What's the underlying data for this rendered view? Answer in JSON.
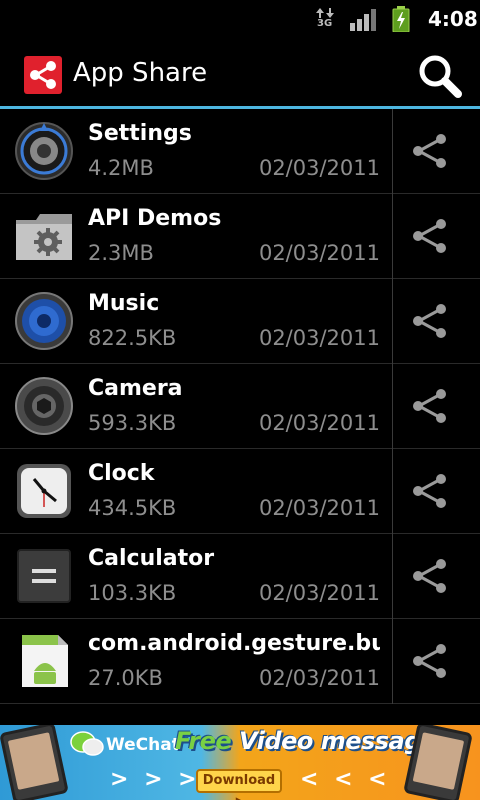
{
  "status_bar": {
    "network": "3G",
    "time": "4:08"
  },
  "header": {
    "title": "App Share",
    "logo_icon": "share-logo-icon",
    "search_icon": "search-icon",
    "accent_color": "#4eb7e1"
  },
  "apps": [
    {
      "name": "Settings",
      "size": "4.2MB",
      "date": "02/03/2011",
      "icon": "settings-icon"
    },
    {
      "name": "API Demos",
      "size": "2.3MB",
      "date": "02/03/2011",
      "icon": "folder-gear-icon"
    },
    {
      "name": "Music",
      "size": "822.5KB",
      "date": "02/03/2011",
      "icon": "speaker-icon"
    },
    {
      "name": "Camera",
      "size": "593.3KB",
      "date": "02/03/2011",
      "icon": "camera-icon"
    },
    {
      "name": "Clock",
      "size": "434.5KB",
      "date": "02/03/2011",
      "icon": "clock-icon"
    },
    {
      "name": "Calculator",
      "size": "103.3KB",
      "date": "02/03/2011",
      "icon": "calculator-icon"
    },
    {
      "name": "com.android.gesture.builder",
      "size": "27.0KB",
      "date": "02/03/2011",
      "icon": "android-app-icon"
    }
  ],
  "banner": {
    "brand": "WeChat",
    "tagline_free": "Free",
    "tagline_rest": " Video message",
    "download_label": "Download ▸",
    "chevrons_left": "> > >",
    "chevrons_right": "< < <"
  }
}
